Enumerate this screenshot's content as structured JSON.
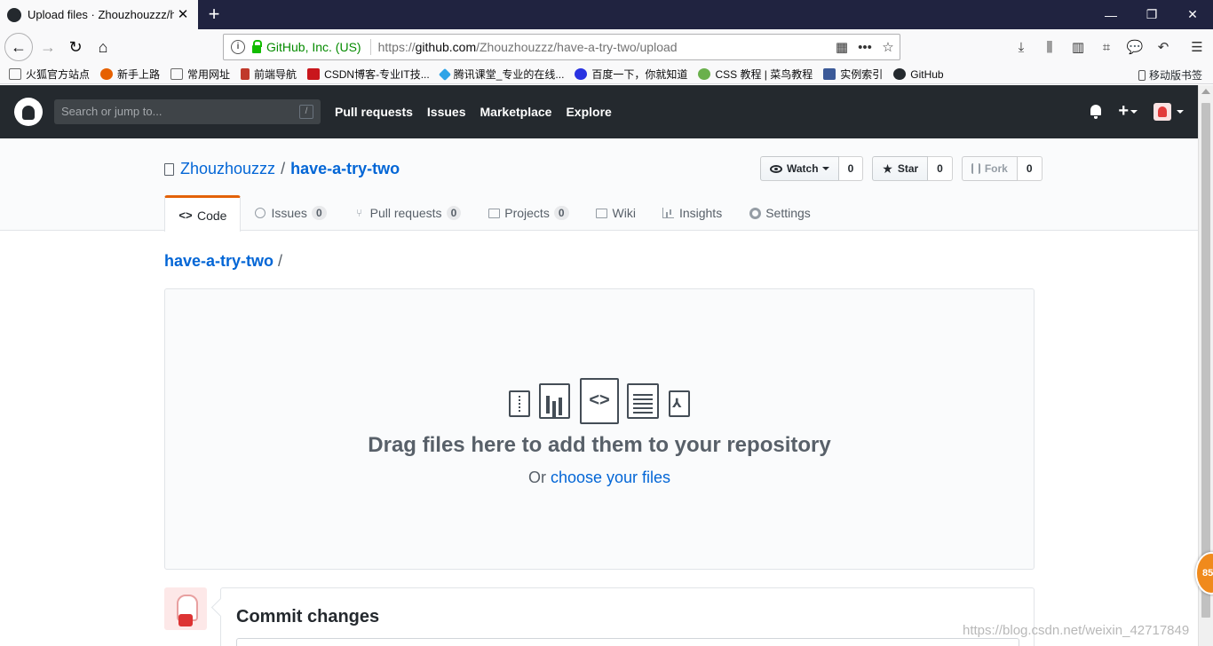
{
  "browser": {
    "tab_title": "Upload files · Zhouzhouzzz/h",
    "new_tab": "+",
    "window_controls": [
      "—",
      "❐",
      "✕"
    ],
    "url_identity": "GitHub, Inc. (US)",
    "url_prefix": "https://",
    "url_domain": "github.com",
    "url_path": "/Zhouzhouzzz/have-a-try-two/upload",
    "bookmarks": [
      {
        "label": "火狐官方站点",
        "color": "#6b6b6b"
      },
      {
        "label": "新手上路",
        "color": "#e66000"
      },
      {
        "label": "常用网址",
        "color": "#6b6b6b"
      },
      {
        "label": "前端导航",
        "color": "#c0392b"
      },
      {
        "label": "CSDN博客-专业IT技...",
        "color": "#c9161c"
      },
      {
        "label": "腾讯课堂_专业的在线...",
        "color": "#2fa4e7"
      },
      {
        "label": "百度一下，你就知道",
        "color": "#2932e1"
      },
      {
        "label": "CSS 教程 | 菜鸟教程",
        "color": "#6ab04c"
      },
      {
        "label": "实例索引",
        "color": "#3b5998"
      },
      {
        "label": "GitHub",
        "color": "#24292e"
      }
    ],
    "mobile_bookmarks": "移动版书签"
  },
  "header": {
    "search_placeholder": "Search or jump to...",
    "search_shortcut": "/",
    "nav": [
      "Pull requests",
      "Issues",
      "Marketplace",
      "Explore"
    ],
    "plus": "+"
  },
  "repo": {
    "owner": "Zhouzhouzzz",
    "separator": "/",
    "name": "have-a-try-two",
    "watch_label": "Watch",
    "watch_count": "0",
    "star_label": "Star",
    "star_count": "0",
    "fork_label": "Fork",
    "fork_count": "0",
    "tabs": [
      {
        "label": "Code",
        "count": ""
      },
      {
        "label": "Issues",
        "count": "0"
      },
      {
        "label": "Pull requests",
        "count": "0"
      },
      {
        "label": "Projects",
        "count": "0"
      },
      {
        "label": "Wiki",
        "count": ""
      },
      {
        "label": "Insights",
        "count": ""
      },
      {
        "label": "Settings",
        "count": ""
      }
    ]
  },
  "breadcrumb": {
    "repo": "have-a-try-two",
    "separator": "/"
  },
  "dropzone": {
    "title": "Drag files here to add them to your repository",
    "or_text": "Or ",
    "choose_link": "choose your files"
  },
  "commit": {
    "title": "Commit changes"
  },
  "float_badge": "85",
  "watermark": "https://blog.csdn.net/weixin_42717849"
}
